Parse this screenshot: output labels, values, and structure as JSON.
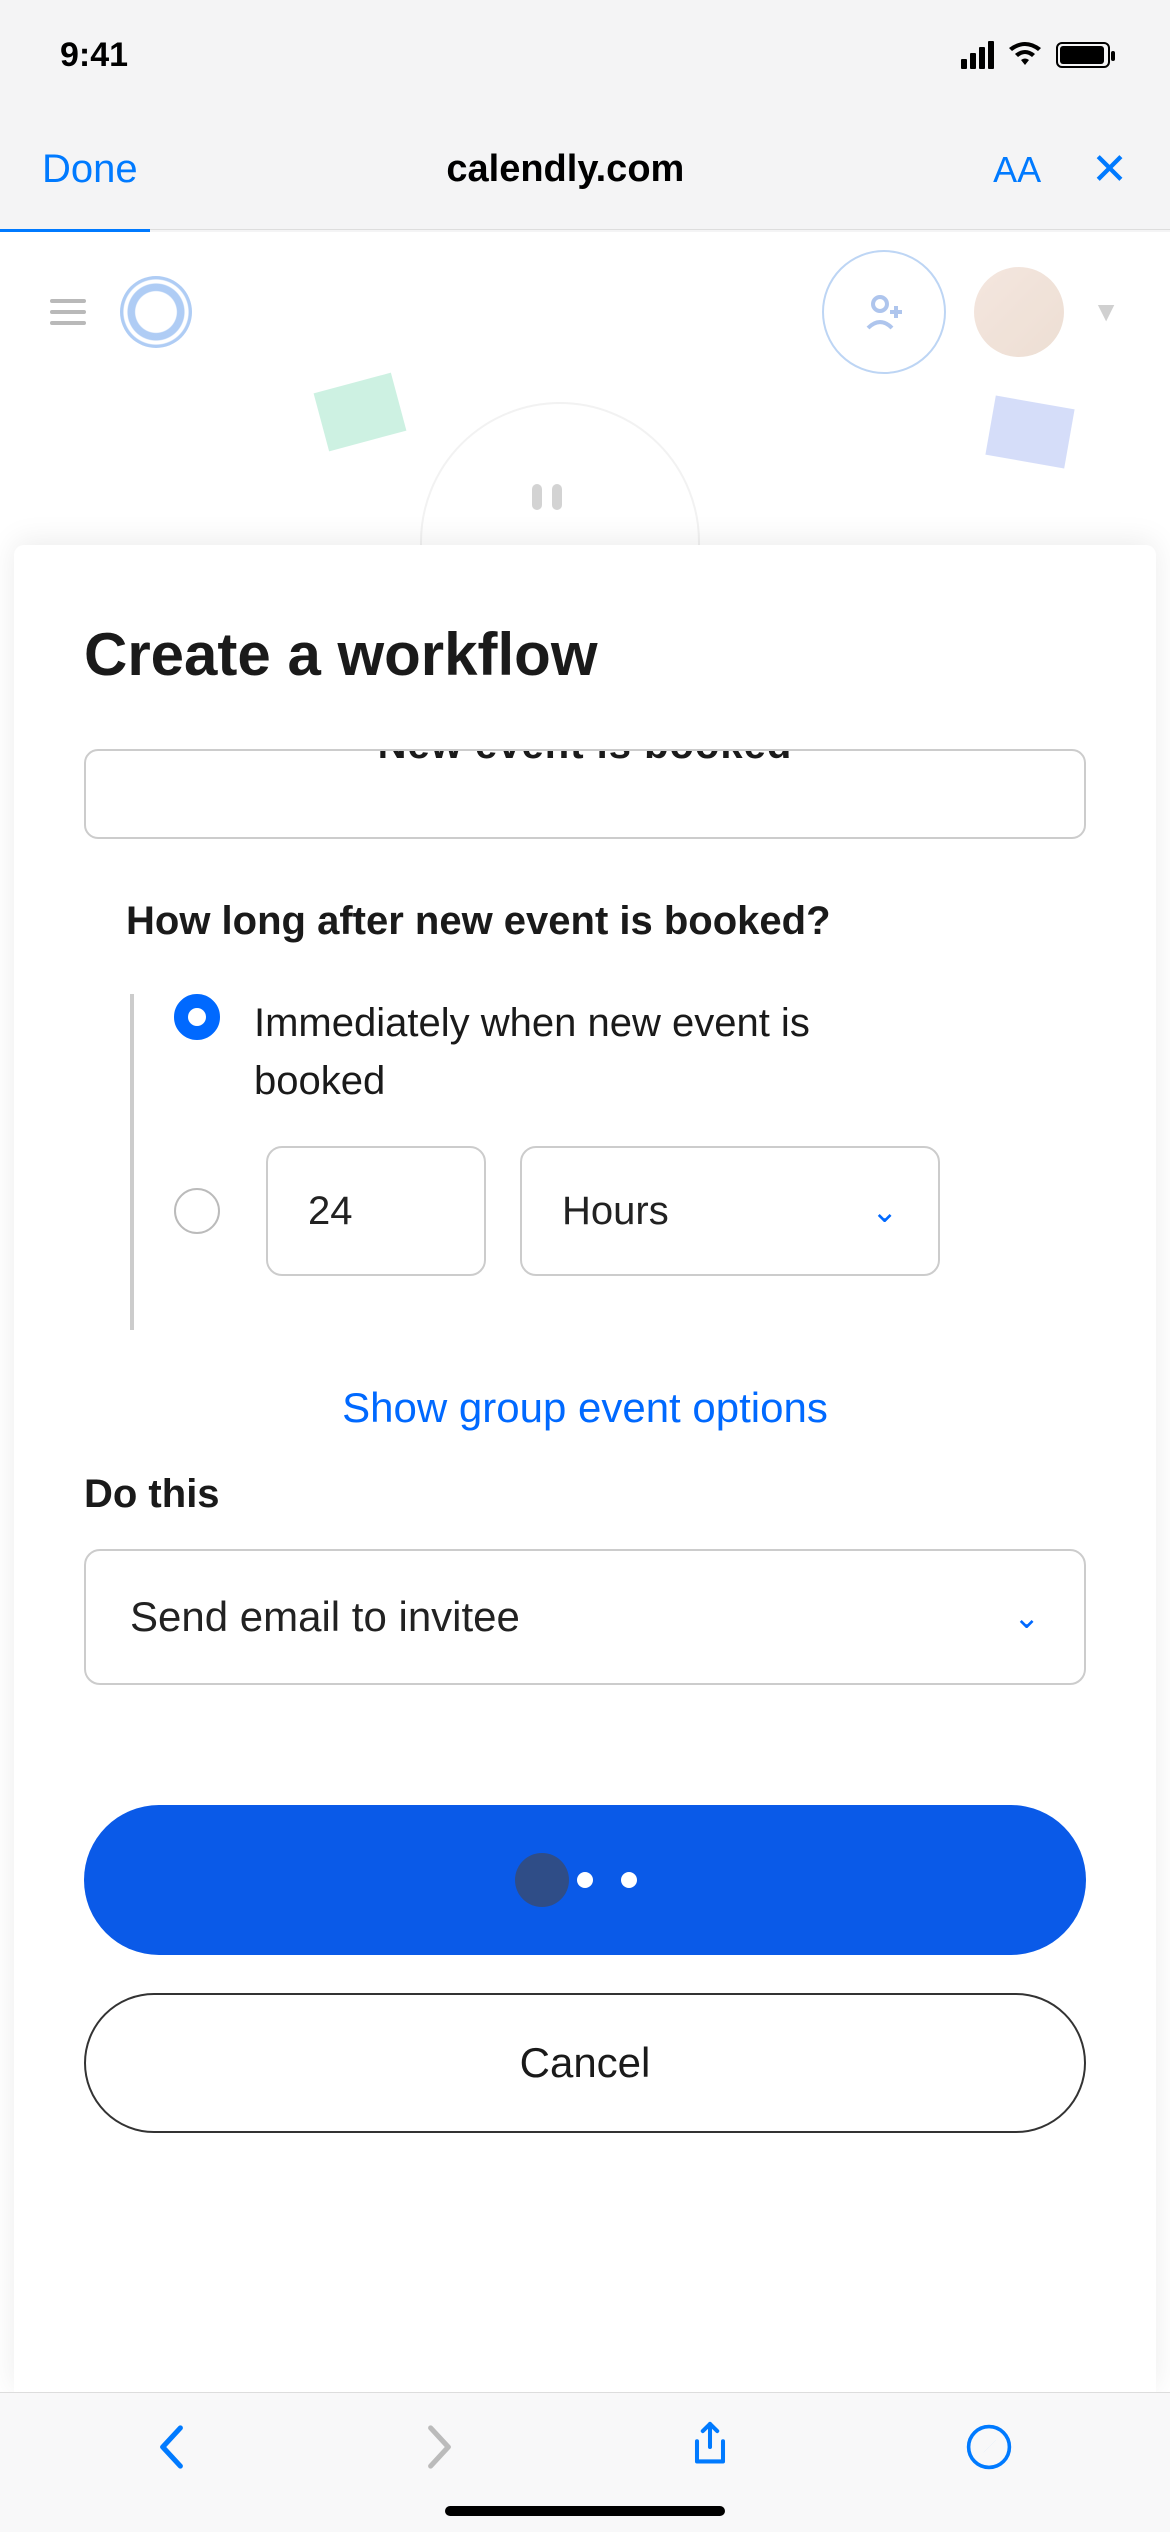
{
  "status": {
    "time": "9:41"
  },
  "browser": {
    "done_label": "Done",
    "url": "calendly.com",
    "aa_label": "AA",
    "close_label": "✕"
  },
  "sheet": {
    "title": "Create a workflow",
    "trigger_truncated": "New event is booked",
    "timing_question": "How long after new event is booked?",
    "radio_immediate": "Immediately when new event is booked",
    "delay_value": "24",
    "delay_unit": "Hours",
    "group_link": "Show group event options",
    "do_label": "Do this",
    "action_selected": "Send email to invitee",
    "cancel_label": "Cancel"
  }
}
